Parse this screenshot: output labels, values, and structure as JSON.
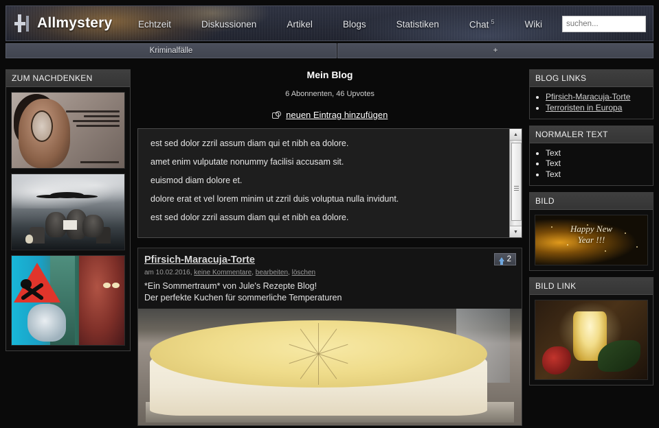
{
  "header": {
    "logo_text": "Allmystery",
    "nav": [
      {
        "label": "Echtzeit",
        "badge": ""
      },
      {
        "label": "Diskussionen",
        "badge": ""
      },
      {
        "label": "Artikel",
        "badge": ""
      },
      {
        "label": "Blogs",
        "badge": ""
      },
      {
        "label": "Statistiken",
        "badge": ""
      },
      {
        "label": "Chat",
        "badge": "5"
      },
      {
        "label": "Wiki",
        "badge": ""
      }
    ],
    "search": {
      "placeholder": "suchen...",
      "value": ""
    }
  },
  "subnav": {
    "tab_left": "Kriminalfälle",
    "tab_right": "+"
  },
  "left_sidebar": {
    "panel_title": "ZUM NACHDENKEN",
    "images": [
      {
        "alt": "Kampagnen-Anzeige Frau mit Benzin"
      },
      {
        "alt": "Affen auf Friedhof"
      },
      {
        "alt": "Gefahrensymbol mit Gesicht"
      }
    ],
    "ad_lines": [
      "Frau mit Benzin übergießen.",
      "Rasch anzünden.",
      "Zusehen, wie sie brennt.",
      "Genugtuung empfinden."
    ],
    "ad_brand": "TERRE DES FEMMES"
  },
  "main": {
    "blog_title": "Mein Blog",
    "blog_stats": "6 Abonnenten, 46 Upvotes",
    "add_entry_label": "neuen Eintrag hinzufügen",
    "textbox_paragraphs": [
      "est sed dolor zzril assum diam qui et nibh ea dolore.",
      "amet enim vulputate nonummy facilisi accusam sit.",
      "euismod diam dolore et.",
      "dolore erat et vel lorem minim ut zzril duis voluptua nulla invidunt.",
      "est sed dolor zzril assum diam qui et nibh ea dolore."
    ],
    "post": {
      "title": "Pfirsich-Maracuja-Torte",
      "meta_date": "am 10.02.2016,",
      "meta_comments": "keine Kommentare",
      "meta_sep1": ",",
      "meta_edit": "bearbeiten",
      "meta_sep2": ",",
      "meta_delete": "löschen",
      "body_line1": "*Ein Sommertraum* von Jule's Rezepte Blog!",
      "body_line2": "Der perfekte Kuchen für sommerliche Temperaturen",
      "votes": "2",
      "image_alt": "Pfirsich-Maracuja-Torte Foto"
    }
  },
  "right_sidebar": {
    "panels": [
      {
        "title": "BLOG LINKS",
        "type": "links",
        "items": [
          "Pfirsich-Maracuja-Torte",
          "Terroristen in Europa"
        ]
      },
      {
        "title": "NORMALER TEXT",
        "type": "text",
        "items": [
          "Text",
          "Text",
          "Text"
        ]
      },
      {
        "title": "BILD",
        "type": "image",
        "image_text_line1": "Happy New",
        "image_text_line2": "Year !!!"
      },
      {
        "title": "BILD LINK",
        "type": "image",
        "image_alt": "Kerze mit Rose"
      }
    ]
  },
  "colors": {
    "page_bg": "#0a0a0a",
    "header_bg": "#282c39",
    "panel_head": "#3f3f3f",
    "accent_link": "#d6d6d6",
    "vote_arrow": "#6fa8e0"
  }
}
